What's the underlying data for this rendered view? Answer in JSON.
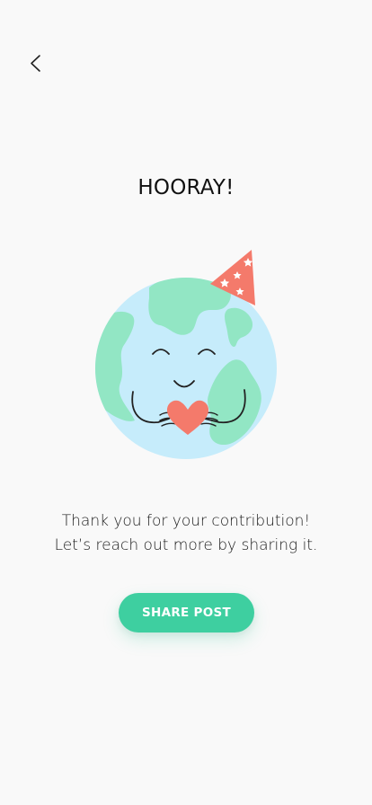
{
  "nav": {
    "back_icon": "chevron-left-icon"
  },
  "header": {
    "title": "HOORAY!"
  },
  "illustration": {
    "subject": "smiling-earth-party-hat-heart",
    "colors": {
      "ocean": "#c6ecfb",
      "land": "#92e6c4",
      "hat": "#f47a6b",
      "heart": "#f47a6b",
      "stroke": "#222222"
    }
  },
  "message": {
    "line1": "Thank you for your contribution!",
    "line2": "Let’s reach out more by sharing it."
  },
  "actions": {
    "share_label": "SHARE POST",
    "accent": "#3ecfa0"
  }
}
